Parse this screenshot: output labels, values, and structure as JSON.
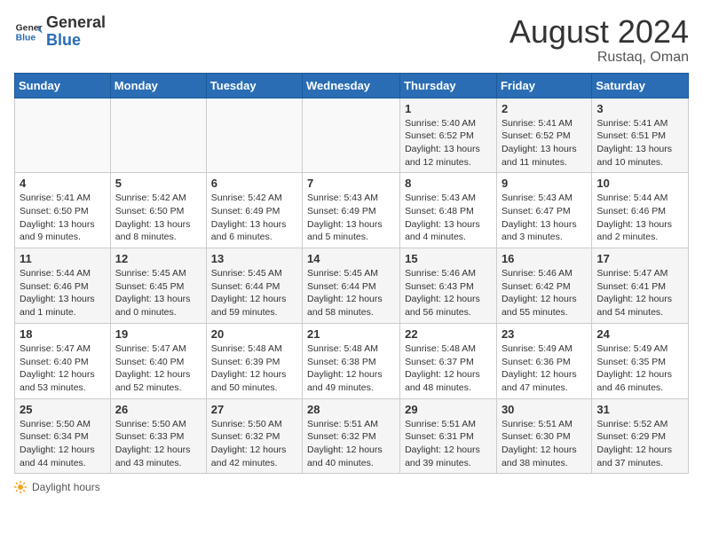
{
  "header": {
    "logo_general": "General",
    "logo_blue": "Blue",
    "month_year": "August 2024",
    "location": "Rustaq, Oman"
  },
  "days_of_week": [
    "Sunday",
    "Monday",
    "Tuesday",
    "Wednesday",
    "Thursday",
    "Friday",
    "Saturday"
  ],
  "weeks": [
    [
      {
        "day": "",
        "sunrise": "",
        "sunset": "",
        "daylight": ""
      },
      {
        "day": "",
        "sunrise": "",
        "sunset": "",
        "daylight": ""
      },
      {
        "day": "",
        "sunrise": "",
        "sunset": "",
        "daylight": ""
      },
      {
        "day": "",
        "sunrise": "",
        "sunset": "",
        "daylight": ""
      },
      {
        "day": "1",
        "sunrise": "Sunrise: 5:40 AM",
        "sunset": "Sunset: 6:52 PM",
        "daylight": "Daylight: 13 hours and 12 minutes."
      },
      {
        "day": "2",
        "sunrise": "Sunrise: 5:41 AM",
        "sunset": "Sunset: 6:52 PM",
        "daylight": "Daylight: 13 hours and 11 minutes."
      },
      {
        "day": "3",
        "sunrise": "Sunrise: 5:41 AM",
        "sunset": "Sunset: 6:51 PM",
        "daylight": "Daylight: 13 hours and 10 minutes."
      }
    ],
    [
      {
        "day": "4",
        "sunrise": "Sunrise: 5:41 AM",
        "sunset": "Sunset: 6:50 PM",
        "daylight": "Daylight: 13 hours and 9 minutes."
      },
      {
        "day": "5",
        "sunrise": "Sunrise: 5:42 AM",
        "sunset": "Sunset: 6:50 PM",
        "daylight": "Daylight: 13 hours and 8 minutes."
      },
      {
        "day": "6",
        "sunrise": "Sunrise: 5:42 AM",
        "sunset": "Sunset: 6:49 PM",
        "daylight": "Daylight: 13 hours and 6 minutes."
      },
      {
        "day": "7",
        "sunrise": "Sunrise: 5:43 AM",
        "sunset": "Sunset: 6:49 PM",
        "daylight": "Daylight: 13 hours and 5 minutes."
      },
      {
        "day": "8",
        "sunrise": "Sunrise: 5:43 AM",
        "sunset": "Sunset: 6:48 PM",
        "daylight": "Daylight: 13 hours and 4 minutes."
      },
      {
        "day": "9",
        "sunrise": "Sunrise: 5:43 AM",
        "sunset": "Sunset: 6:47 PM",
        "daylight": "Daylight: 13 hours and 3 minutes."
      },
      {
        "day": "10",
        "sunrise": "Sunrise: 5:44 AM",
        "sunset": "Sunset: 6:46 PM",
        "daylight": "Daylight: 13 hours and 2 minutes."
      }
    ],
    [
      {
        "day": "11",
        "sunrise": "Sunrise: 5:44 AM",
        "sunset": "Sunset: 6:46 PM",
        "daylight": "Daylight: 13 hours and 1 minute."
      },
      {
        "day": "12",
        "sunrise": "Sunrise: 5:45 AM",
        "sunset": "Sunset: 6:45 PM",
        "daylight": "Daylight: 13 hours and 0 minutes."
      },
      {
        "day": "13",
        "sunrise": "Sunrise: 5:45 AM",
        "sunset": "Sunset: 6:44 PM",
        "daylight": "Daylight: 12 hours and 59 minutes."
      },
      {
        "day": "14",
        "sunrise": "Sunrise: 5:45 AM",
        "sunset": "Sunset: 6:44 PM",
        "daylight": "Daylight: 12 hours and 58 minutes."
      },
      {
        "day": "15",
        "sunrise": "Sunrise: 5:46 AM",
        "sunset": "Sunset: 6:43 PM",
        "daylight": "Daylight: 12 hours and 56 minutes."
      },
      {
        "day": "16",
        "sunrise": "Sunrise: 5:46 AM",
        "sunset": "Sunset: 6:42 PM",
        "daylight": "Daylight: 12 hours and 55 minutes."
      },
      {
        "day": "17",
        "sunrise": "Sunrise: 5:47 AM",
        "sunset": "Sunset: 6:41 PM",
        "daylight": "Daylight: 12 hours and 54 minutes."
      }
    ],
    [
      {
        "day": "18",
        "sunrise": "Sunrise: 5:47 AM",
        "sunset": "Sunset: 6:40 PM",
        "daylight": "Daylight: 12 hours and 53 minutes."
      },
      {
        "day": "19",
        "sunrise": "Sunrise: 5:47 AM",
        "sunset": "Sunset: 6:40 PM",
        "daylight": "Daylight: 12 hours and 52 minutes."
      },
      {
        "day": "20",
        "sunrise": "Sunrise: 5:48 AM",
        "sunset": "Sunset: 6:39 PM",
        "daylight": "Daylight: 12 hours and 50 minutes."
      },
      {
        "day": "21",
        "sunrise": "Sunrise: 5:48 AM",
        "sunset": "Sunset: 6:38 PM",
        "daylight": "Daylight: 12 hours and 49 minutes."
      },
      {
        "day": "22",
        "sunrise": "Sunrise: 5:48 AM",
        "sunset": "Sunset: 6:37 PM",
        "daylight": "Daylight: 12 hours and 48 minutes."
      },
      {
        "day": "23",
        "sunrise": "Sunrise: 5:49 AM",
        "sunset": "Sunset: 6:36 PM",
        "daylight": "Daylight: 12 hours and 47 minutes."
      },
      {
        "day": "24",
        "sunrise": "Sunrise: 5:49 AM",
        "sunset": "Sunset: 6:35 PM",
        "daylight": "Daylight: 12 hours and 46 minutes."
      }
    ],
    [
      {
        "day": "25",
        "sunrise": "Sunrise: 5:50 AM",
        "sunset": "Sunset: 6:34 PM",
        "daylight": "Daylight: 12 hours and 44 minutes."
      },
      {
        "day": "26",
        "sunrise": "Sunrise: 5:50 AM",
        "sunset": "Sunset: 6:33 PM",
        "daylight": "Daylight: 12 hours and 43 minutes."
      },
      {
        "day": "27",
        "sunrise": "Sunrise: 5:50 AM",
        "sunset": "Sunset: 6:32 PM",
        "daylight": "Daylight: 12 hours and 42 minutes."
      },
      {
        "day": "28",
        "sunrise": "Sunrise: 5:51 AM",
        "sunset": "Sunset: 6:32 PM",
        "daylight": "Daylight: 12 hours and 40 minutes."
      },
      {
        "day": "29",
        "sunrise": "Sunrise: 5:51 AM",
        "sunset": "Sunset: 6:31 PM",
        "daylight": "Daylight: 12 hours and 39 minutes."
      },
      {
        "day": "30",
        "sunrise": "Sunrise: 5:51 AM",
        "sunset": "Sunset: 6:30 PM",
        "daylight": "Daylight: 12 hours and 38 minutes."
      },
      {
        "day": "31",
        "sunrise": "Sunrise: 5:52 AM",
        "sunset": "Sunset: 6:29 PM",
        "daylight": "Daylight: 12 hours and 37 minutes."
      }
    ]
  ],
  "legend": {
    "daylight_hours": "Daylight hours"
  }
}
